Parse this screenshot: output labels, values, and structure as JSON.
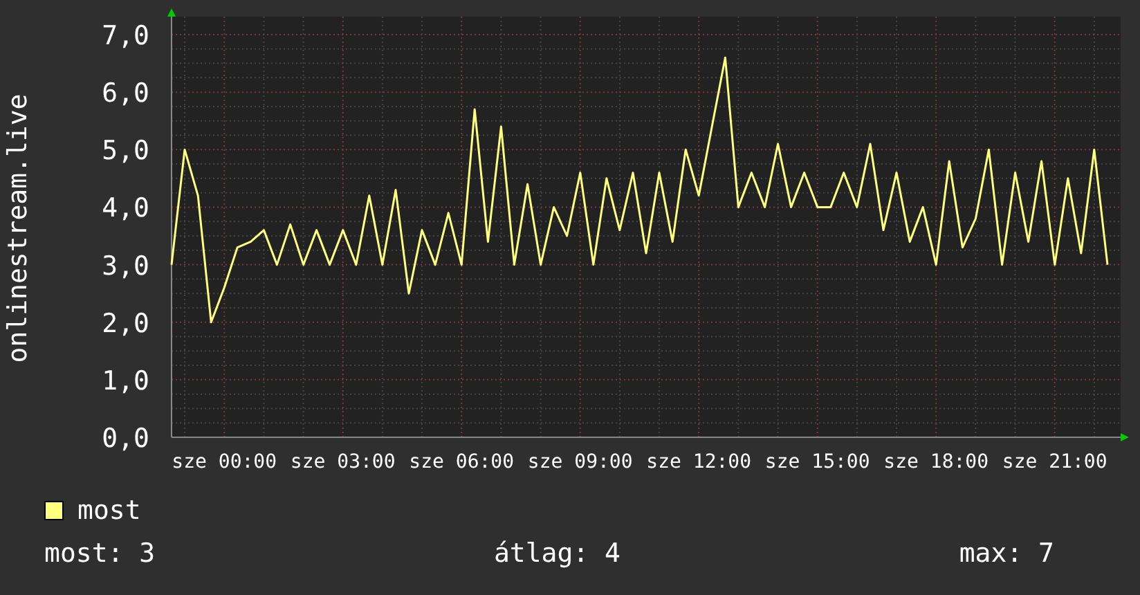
{
  "graph": {
    "chart_data": {
      "type": "line",
      "ylabel": "onlinestream.live",
      "categories": [
        null,
        null,
        null,
        null,
        "sze 00:00",
        null,
        null,
        null,
        null,
        null,
        null,
        null,
        null,
        "sze 03:00",
        null,
        null,
        null,
        null,
        null,
        null,
        null,
        null,
        "sze 06:00",
        null,
        null,
        null,
        null,
        null,
        null,
        null,
        null,
        "sze 09:00",
        null,
        null,
        null,
        null,
        null,
        null,
        null,
        null,
        "sze 12:00",
        null,
        null,
        null,
        null,
        null,
        null,
        null,
        null,
        "sze 15:00",
        null,
        null,
        null,
        null,
        null,
        null,
        null,
        null,
        "sze 18:00",
        null,
        null,
        null,
        null,
        null,
        null,
        null,
        null,
        "sze 21:00",
        null,
        null,
        null,
        null
      ],
      "series": [
        {
          "name": "most",
          "color": "#ffff80",
          "values": [
            3.0,
            5.0,
            4.2,
            2.0,
            2.6,
            3.3,
            3.4,
            3.6,
            3.0,
            3.7,
            3.0,
            3.6,
            3.0,
            3.6,
            3.0,
            4.2,
            3.0,
            4.3,
            2.5,
            3.6,
            3.0,
            3.9,
            3.0,
            5.7,
            3.4,
            5.4,
            3.0,
            4.4,
            3.0,
            4.0,
            3.5,
            4.6,
            3.0,
            4.5,
            3.6,
            4.6,
            3.2,
            4.6,
            3.4,
            5.0,
            4.2,
            5.4,
            6.6,
            4.0,
            4.6,
            4.0,
            5.1,
            4.0,
            4.6,
            4.0,
            4.0,
            4.6,
            4.0,
            5.1,
            3.6,
            4.6,
            3.4,
            4.0,
            3.0,
            4.8,
            3.3,
            3.8,
            5.0,
            3.0,
            4.6,
            3.4,
            4.8,
            3.0,
            4.5,
            3.2,
            5.0,
            3.0
          ]
        }
      ],
      "ylim": [
        0,
        7
      ],
      "grid": true,
      "yticks": [
        {
          "value": 0,
          "label": "0,0"
        },
        {
          "value": 1,
          "label": "1,0"
        },
        {
          "value": 2,
          "label": "2,0"
        },
        {
          "value": 3,
          "label": "3,0"
        },
        {
          "value": 4,
          "label": "4,0"
        },
        {
          "value": 5,
          "label": "5,0"
        },
        {
          "value": 6,
          "label": "6,0"
        },
        {
          "value": 7,
          "label": "7,0"
        }
      ]
    }
  },
  "stats": [
    "most: 3",
    "átlag: 4",
    "max: 7"
  ]
}
